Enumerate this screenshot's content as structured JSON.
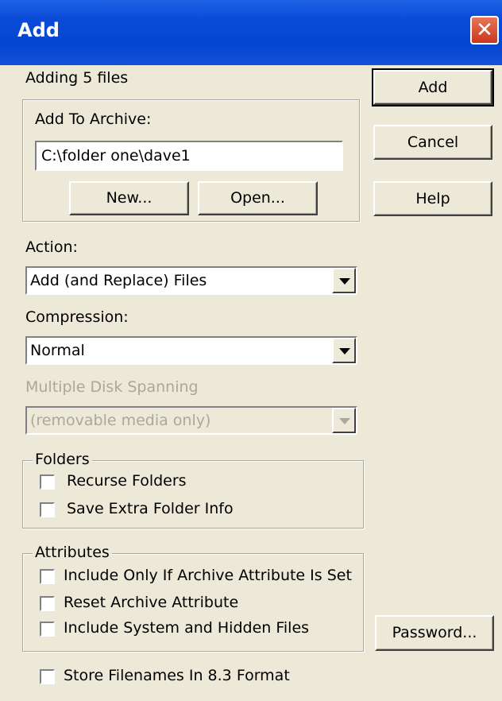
{
  "window": {
    "title": "Add"
  },
  "status": {
    "adding_text": "Adding 5 files"
  },
  "archive": {
    "group_label": "Add To Archive:",
    "path_value": "C:\\folder one\\dave1",
    "new_button": "New...",
    "open_button": "Open..."
  },
  "buttons": {
    "add": "Add",
    "cancel": "Cancel",
    "help": "Help",
    "password": "Password..."
  },
  "action": {
    "label": "Action:",
    "selected": "Add (and Replace) Files"
  },
  "compression": {
    "label": "Compression:",
    "selected": "Normal"
  },
  "spanning": {
    "label": "Multiple Disk Spanning",
    "selected": "(removable media only)"
  },
  "folders": {
    "title": "Folders",
    "recurse": "Recurse Folders",
    "save_extra": "Save Extra Folder Info"
  },
  "attributes": {
    "title": "Attributes",
    "include_archive": "Include Only If Archive Attribute Is Set",
    "reset_archive": "Reset Archive Attribute",
    "include_system": "Include System and Hidden Files"
  },
  "store_83": "Store Filenames In 8.3 Format",
  "colors": {
    "titlebar": "#0a4ad8",
    "dialog_bg": "#ece9d8",
    "close_button": "#c8381c"
  }
}
